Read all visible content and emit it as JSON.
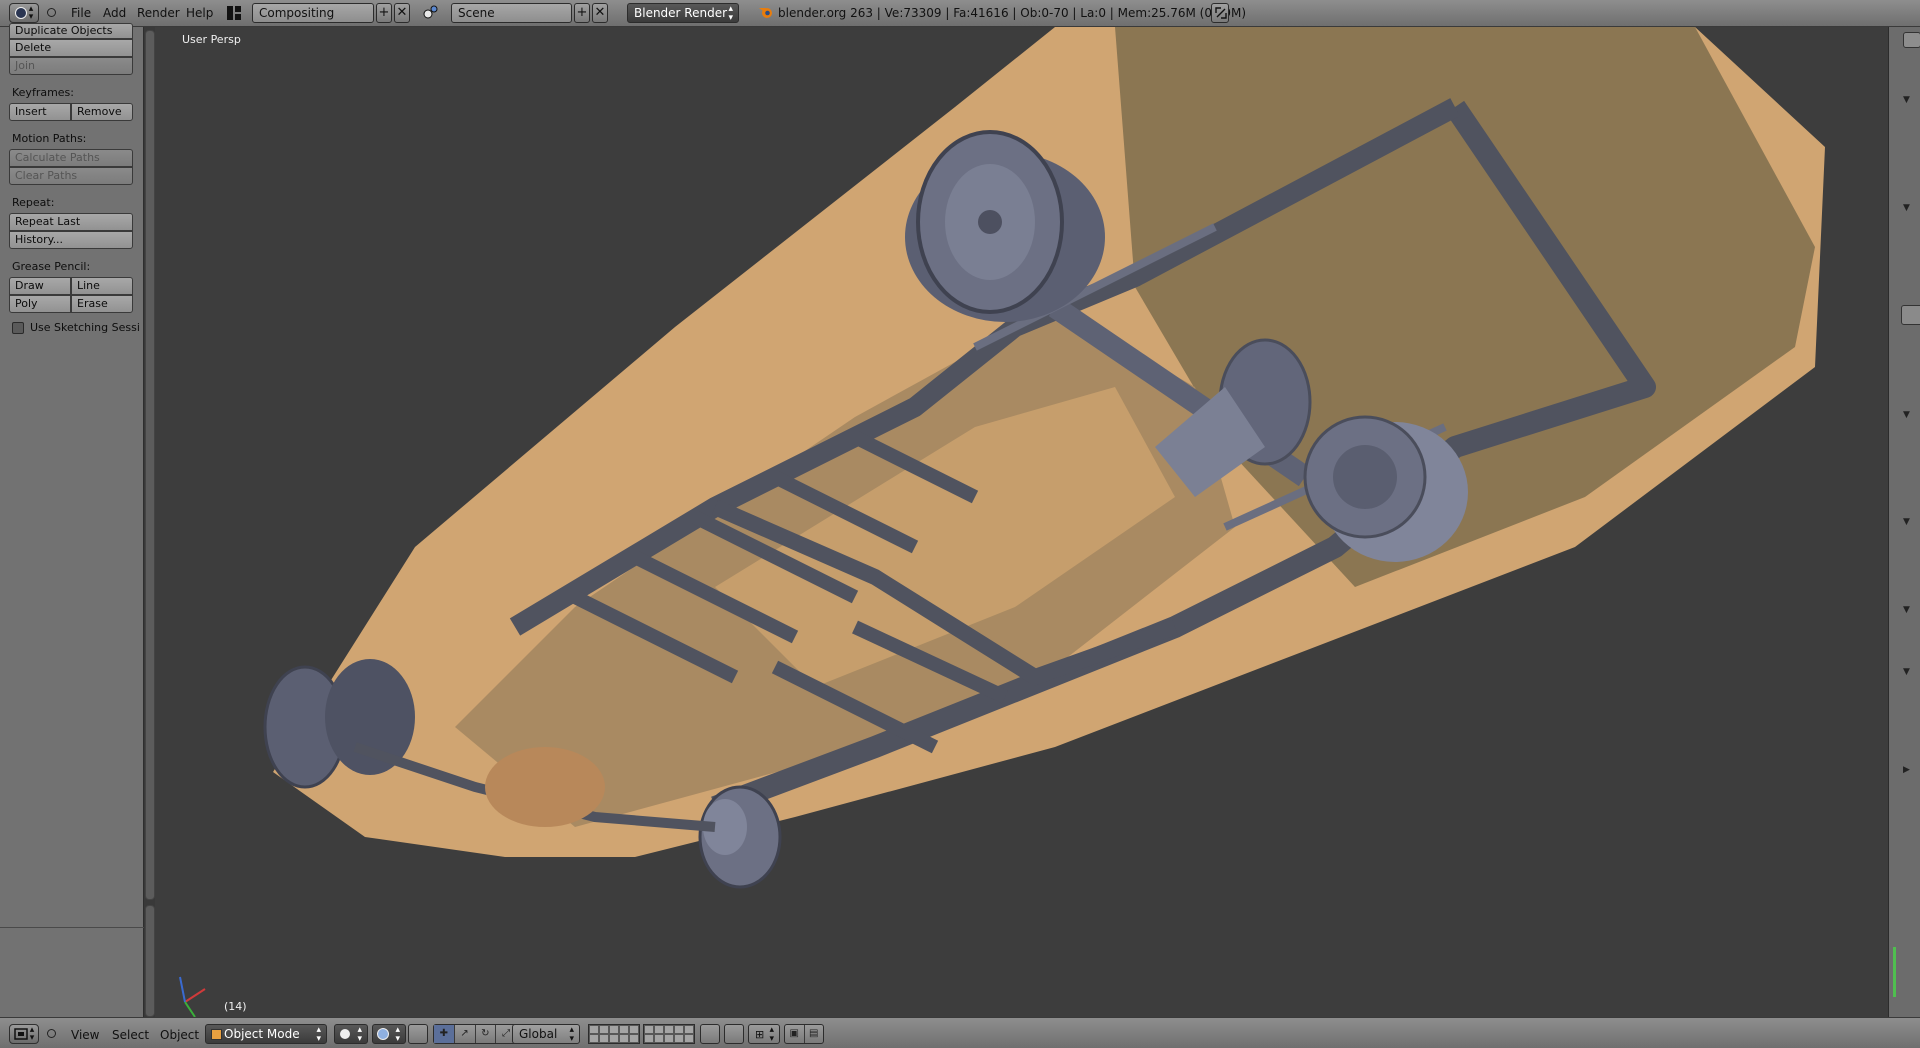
{
  "topbar": {
    "menus": [
      "File",
      "Add",
      "Render",
      "Help"
    ],
    "screen_layout": "Compositing",
    "scene": "Scene",
    "render_engine": "Blender Render",
    "stats": "blender.org 263 | Ve:73309 | Fa:41616 | Ob:0-70 | La:0 | Mem:25.76M (0.59M)"
  },
  "toolshelf": {
    "edit_buttons": [
      "Duplicate Objects",
      "Delete",
      "Join"
    ],
    "keyframes_label": "Keyframes:",
    "keyframes_buttons": [
      "Insert",
      "Remove"
    ],
    "motion_paths_label": "Motion Paths:",
    "motion_paths_buttons": [
      "Calculate Paths",
      "Clear Paths"
    ],
    "repeat_label": "Repeat:",
    "repeat_buttons": [
      "Repeat Last",
      "History..."
    ],
    "grease_pencil_label": "Grease Pencil:",
    "grease_pencil_buttons": [
      "Draw",
      "Line",
      "Poly",
      "Erase"
    ],
    "sketching_checkbox": "Use Sketching Sessio"
  },
  "viewport": {
    "view_label": "User Persp",
    "frame_label": "(14)",
    "colors": {
      "body": "#d8b07a",
      "frame": "#50535f",
      "wheel": "#6a6e80",
      "background": "#3d3d3d"
    }
  },
  "bottombar": {
    "menus": [
      "View",
      "Select",
      "Object"
    ],
    "mode": "Object Mode",
    "orientation": "Global"
  }
}
